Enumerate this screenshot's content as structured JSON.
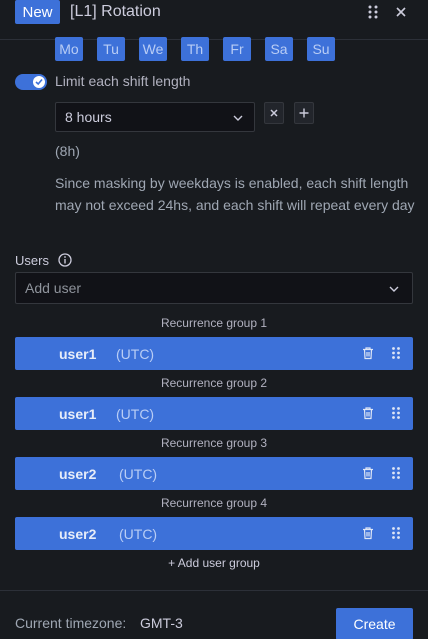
{
  "header": {
    "badge": "New",
    "title": "[L1] Rotation"
  },
  "weekdays": [
    "Mo",
    "Tu",
    "We",
    "Th",
    "Fr",
    "Sa",
    "Su"
  ],
  "limit_shift": {
    "enabled": true,
    "label": "Limit each shift length",
    "selected": "8 hours",
    "hours_note": "(8h)",
    "mask_note": "Since masking by weekdays is enabled, each shift length may not exceed 24hs, and each shift will repeat every day"
  },
  "users": {
    "label": "Users",
    "placeholder": "Add user",
    "groups": [
      {
        "label": "Recurrence group 1",
        "name": "user1",
        "tz": "(UTC)"
      },
      {
        "label": "Recurrence group 2",
        "name": "user1",
        "tz": "(UTC)"
      },
      {
        "label": "Recurrence group 3",
        "name": "user2",
        "tz": "(UTC)"
      },
      {
        "label": "Recurrence group 4",
        "name": "user2",
        "tz": "(UTC)"
      }
    ],
    "add_group": "+ Add user group"
  },
  "footer": {
    "tz_label": "Current timezone:",
    "tz_value": "GMT-3",
    "create": "Create"
  },
  "colors": {
    "accent": "#3d71d9",
    "background": "#181b1f"
  }
}
